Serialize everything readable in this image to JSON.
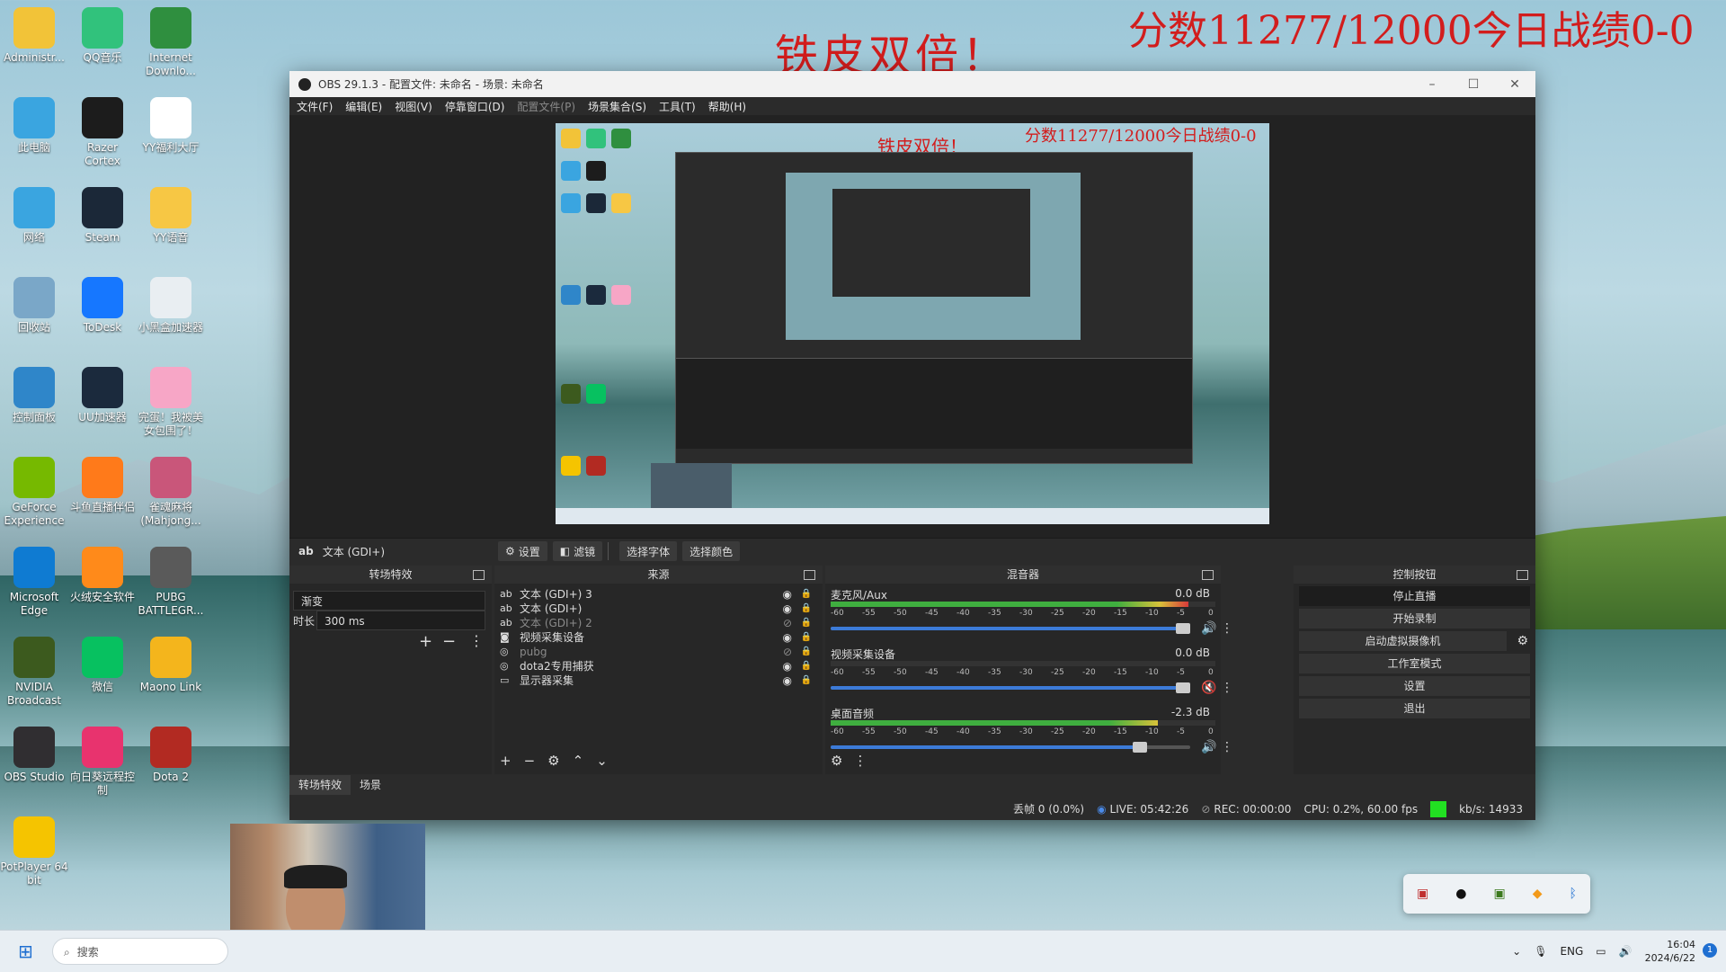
{
  "overlay": {
    "title_left": "铁皮双倍！",
    "title_right": "分数11277/12000今日战绩0-0"
  },
  "desktop_icons": [
    {
      "label": "Administr...",
      "color": "#f2c338",
      "glyph": "folder-icon"
    },
    {
      "label": "此电脑",
      "color": "#3aa5e0",
      "glyph": "monitor-icon"
    },
    {
      "label": "网络",
      "color": "#3aa5e0",
      "glyph": "network-icon"
    },
    {
      "label": "回收站",
      "color": "#7aa7c8",
      "glyph": "recycle-icon"
    },
    {
      "label": "控制面板",
      "color": "#2f86c9",
      "glyph": "control-panel-icon"
    },
    {
      "label": "GeForce Experience",
      "color": "#76b900",
      "glyph": "geforce-icon"
    },
    {
      "label": "Microsoft Edge",
      "color": "#0f7bd2",
      "glyph": "edge-icon"
    },
    {
      "label": "NVIDIA Broadcast",
      "color": "#3c5a1e",
      "glyph": "nvidia-broadcast-icon"
    },
    {
      "label": "OBS Studio",
      "color": "#302e31",
      "glyph": "obs-icon"
    },
    {
      "label": "PotPlayer 64 bit",
      "color": "#f5c400",
      "glyph": "potplayer-icon"
    },
    {
      "label": "QQ音乐",
      "color": "#31c27c",
      "glyph": "qqmusic-icon"
    },
    {
      "label": "Razer Cortex",
      "color": "#1c1c1c",
      "glyph": "razer-icon"
    },
    {
      "label": "Steam",
      "color": "#1b2838",
      "glyph": "steam-icon"
    },
    {
      "label": "ToDesk",
      "color": "#1677ff",
      "glyph": "todesk-icon"
    },
    {
      "label": "UU加速器",
      "color": "#1b2a3d",
      "glyph": "uu-icon"
    },
    {
      "label": "斗鱼直播伴侣",
      "color": "#ff7a1a",
      "glyph": "douyu-icon"
    },
    {
      "label": "火绒安全软件",
      "color": "#ff8a1a",
      "glyph": "huorong-icon"
    },
    {
      "label": "微信",
      "color": "#07c160",
      "glyph": "wechat-icon"
    },
    {
      "label": "向日葵远程控制",
      "color": "#e8336e",
      "glyph": "sunflower-icon"
    },
    {
      "label": "Internet Downlo...",
      "color": "#2f8f3f",
      "glyph": "idm-icon"
    },
    {
      "label": "YY福利大厅",
      "color": "#ffffff",
      "glyph": "file-icon"
    },
    {
      "label": "YY语音",
      "color": "#f7c744",
      "glyph": "yy-icon"
    },
    {
      "label": "小黑盒加速器",
      "color": "#e9eef2",
      "glyph": "xiaoheihe-icon"
    },
    {
      "label": "完蛋！我被美女包围了！",
      "color": "#f7a6c6",
      "glyph": "heart-icon"
    },
    {
      "label": "雀魂麻将(Mahjong...",
      "color": "#c9567a",
      "glyph": "mahjong-icon"
    },
    {
      "label": "PUBG BATTLEGR...",
      "color": "#5a5a5a",
      "glyph": "pubg-icon"
    },
    {
      "label": "Maono Link",
      "color": "#f4b51c",
      "glyph": "maono-icon"
    },
    {
      "label": "Dota 2",
      "color": "#b22a22",
      "glyph": "dota-icon"
    }
  ],
  "window": {
    "title": "OBS 29.1.3 - 配置文件: 未命名 - 场景: 未命名",
    "controls": {
      "minimize": "–",
      "maximize": "☐",
      "close": "✕"
    }
  },
  "menu": [
    "文件(F)",
    "编辑(E)",
    "视图(V)",
    "停靠窗口(D)",
    "配置文件(P)",
    "场景集合(S)",
    "工具(T)",
    "帮助(H)"
  ],
  "source_toolbar": {
    "source_name": "文本 (GDI+)",
    "buttons": {
      "settings": "设置",
      "filters": "滤镜",
      "select_font": "选择字体",
      "select_color": "选择颜色"
    }
  },
  "transitions": {
    "header": "转场特效",
    "selected": "渐变",
    "duration_label": "时长",
    "duration_value": "300 ms"
  },
  "sources": {
    "header": "来源",
    "items": [
      {
        "name": "文本 (GDI+) 3",
        "type": "ab",
        "visible": true
      },
      {
        "name": "文本 (GDI+)",
        "type": "ab",
        "visible": true
      },
      {
        "name": "文本 (GDI+) 2",
        "type": "ab",
        "visible": false
      },
      {
        "name": "视频采集设备",
        "type": "cam",
        "visible": true
      },
      {
        "name": "pubg",
        "type": "game",
        "visible": false
      },
      {
        "name": "dota2专用捕获",
        "type": "game",
        "visible": true
      },
      {
        "name": "显示器采集",
        "type": "screen",
        "visible": true
      }
    ]
  },
  "mixer": {
    "header": "混音器",
    "ticks": [
      "-60",
      "-55",
      "-50",
      "-45",
      "-40",
      "-35",
      "-30",
      "-25",
      "-20",
      "-15",
      "-10",
      "-5",
      "0"
    ],
    "channels": [
      {
        "name": "麦克风/Aux",
        "db": "0.0 dB",
        "level": 0.93,
        "volume": 0.98,
        "muted": false
      },
      {
        "name": "视频采集设备",
        "db": "0.0 dB",
        "level": 0.0,
        "volume": 0.98,
        "muted": true
      },
      {
        "name": "桌面音频",
        "db": "-2.3 dB",
        "level": 0.85,
        "volume": 0.86,
        "muted": false
      }
    ]
  },
  "controls": {
    "header": "控制按钮",
    "buttons": [
      "停止直播",
      "开始录制",
      "启动虚拟摄像机",
      "工作室模式",
      "设置",
      "退出"
    ]
  },
  "bottom_tabs": {
    "transitions": "转场特效",
    "scenes": "场景"
  },
  "status": {
    "dropped": "丢帧 0 (0.0%)",
    "live": "LIVE: 05:42:26",
    "rec": "REC: 00:00:00",
    "cpu": "CPU: 0.2%, 60.00 fps",
    "kbps": "kb/s: 14933",
    "indicator_color": "#22e022"
  },
  "taskbar": {
    "search_placeholder": "搜索",
    "lang": "ENG",
    "time": "16:04",
    "date": "2024/6/22",
    "notification_count": "1"
  }
}
